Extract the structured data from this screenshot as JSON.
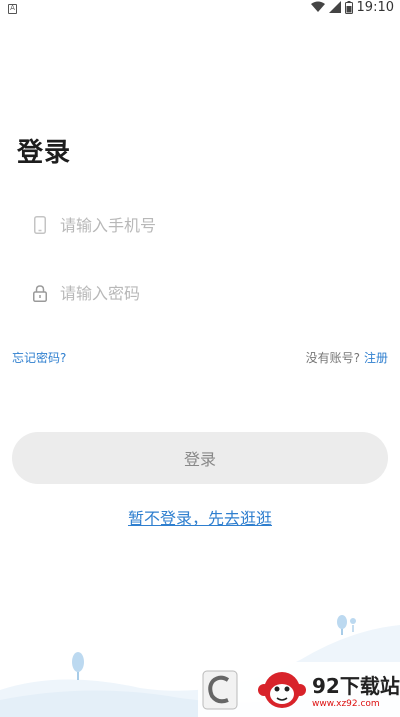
{
  "status_bar": {
    "app_icon_letter": "A",
    "time": "19:10"
  },
  "page": {
    "title": "登录"
  },
  "form": {
    "phone_placeholder": "请输入手机号",
    "password_placeholder": "请输入密码"
  },
  "links": {
    "forgot_password": "忘记密码?",
    "no_account": "没有账号?",
    "register": "注册"
  },
  "login_button_label": "登录",
  "skip_login": "暂不登录，先去逛逛",
  "watermark": {
    "name": "92下载站",
    "url": "www.xz92.com"
  },
  "colors": {
    "accent": "#2f7fcf",
    "button_bg": "#ececec"
  }
}
